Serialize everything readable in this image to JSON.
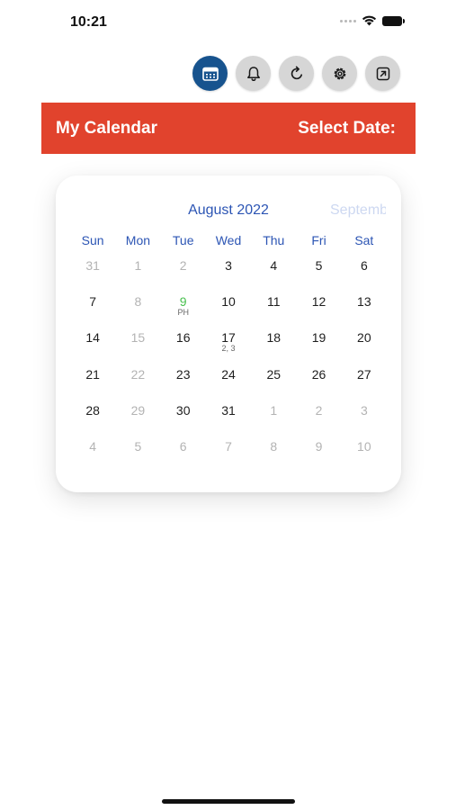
{
  "status_bar": {
    "time": "10:21"
  },
  "toolbar": {
    "buttons": [
      {
        "icon": "calendar-icon",
        "active": true
      },
      {
        "icon": "bell-icon",
        "active": false
      },
      {
        "icon": "refresh-icon",
        "active": false
      },
      {
        "icon": "gear-icon",
        "active": false
      },
      {
        "icon": "share-icon",
        "active": false
      }
    ],
    "active_color": "#17538e",
    "inactive_color": "#d6d6d6"
  },
  "header": {
    "title": "My Calendar",
    "select_label": "Select Date:",
    "background": "#e1432d"
  },
  "calendar": {
    "month_title": "August 2022",
    "next_month_preview": "September",
    "weekdays": [
      "Sun",
      "Mon",
      "Tue",
      "Wed",
      "Thu",
      "Fri",
      "Sat"
    ],
    "accent": "#2c55b4",
    "holiday_color": "#49c04f",
    "weeks": [
      [
        {
          "d": "31",
          "muted": true
        },
        {
          "d": "1",
          "muted": true
        },
        {
          "d": "2",
          "muted": true
        },
        {
          "d": "3"
        },
        {
          "d": "4"
        },
        {
          "d": "5"
        },
        {
          "d": "6"
        }
      ],
      [
        {
          "d": "7"
        },
        {
          "d": "8",
          "muted": true
        },
        {
          "d": "9",
          "holiday": true,
          "note": "PH"
        },
        {
          "d": "10"
        },
        {
          "d": "11"
        },
        {
          "d": "12"
        },
        {
          "d": "13"
        }
      ],
      [
        {
          "d": "14"
        },
        {
          "d": "15",
          "muted": true
        },
        {
          "d": "16"
        },
        {
          "d": "17",
          "note": "2, 3"
        },
        {
          "d": "18"
        },
        {
          "d": "19"
        },
        {
          "d": "20"
        }
      ],
      [
        {
          "d": "21"
        },
        {
          "d": "22",
          "muted": true
        },
        {
          "d": "23"
        },
        {
          "d": "24"
        },
        {
          "d": "25"
        },
        {
          "d": "26"
        },
        {
          "d": "27"
        }
      ],
      [
        {
          "d": "28"
        },
        {
          "d": "29",
          "muted": true
        },
        {
          "d": "30"
        },
        {
          "d": "31"
        },
        {
          "d": "1",
          "muted": true
        },
        {
          "d": "2",
          "muted": true
        },
        {
          "d": "3",
          "muted": true
        }
      ],
      [
        {
          "d": "4",
          "muted": true
        },
        {
          "d": "5",
          "muted": true
        },
        {
          "d": "6",
          "muted": true
        },
        {
          "d": "7",
          "muted": true
        },
        {
          "d": "8",
          "muted": true
        },
        {
          "d": "9",
          "muted": true
        },
        {
          "d": "10",
          "muted": true
        }
      ]
    ]
  }
}
